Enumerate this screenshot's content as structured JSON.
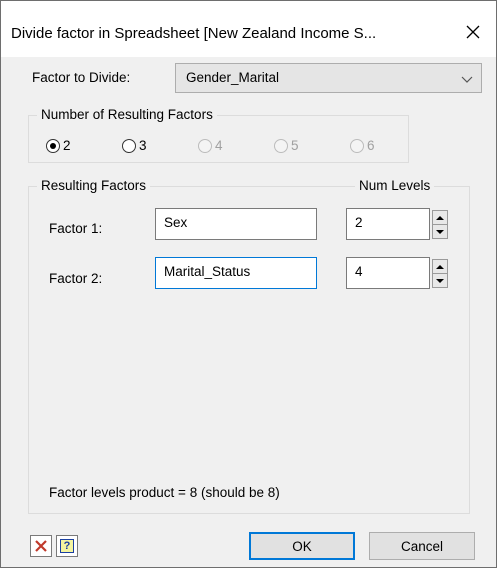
{
  "window": {
    "title": "Divide factor in Spreadsheet [New Zealand Income S...",
    "close_label": "✕"
  },
  "factor_to_divide": {
    "label": "Factor to Divide:",
    "value": "Gender_Marital"
  },
  "num_resulting": {
    "title": "Number of Resulting Factors",
    "options": [
      {
        "label": "2",
        "checked": true,
        "enabled": true
      },
      {
        "label": "3",
        "checked": false,
        "enabled": true
      },
      {
        "label": "4",
        "checked": false,
        "enabled": false
      },
      {
        "label": "5",
        "checked": false,
        "enabled": false
      },
      {
        "label": "6",
        "checked": false,
        "enabled": false
      }
    ]
  },
  "resulting_factors": {
    "title": "Resulting Factors",
    "num_levels_header": "Num Levels",
    "factors": [
      {
        "label": "Factor 1:",
        "name": "Sex",
        "levels": "2"
      },
      {
        "label": "Factor 2:",
        "name": "Marital_Status",
        "levels": "4"
      }
    ],
    "product_text": "Factor levels product = 8 (should be 8)"
  },
  "buttons": {
    "ok": "OK",
    "cancel": "Cancel",
    "help_glyph": "?"
  },
  "colors": {
    "accent": "#0078d7",
    "delete_icon": "#c0392b"
  }
}
